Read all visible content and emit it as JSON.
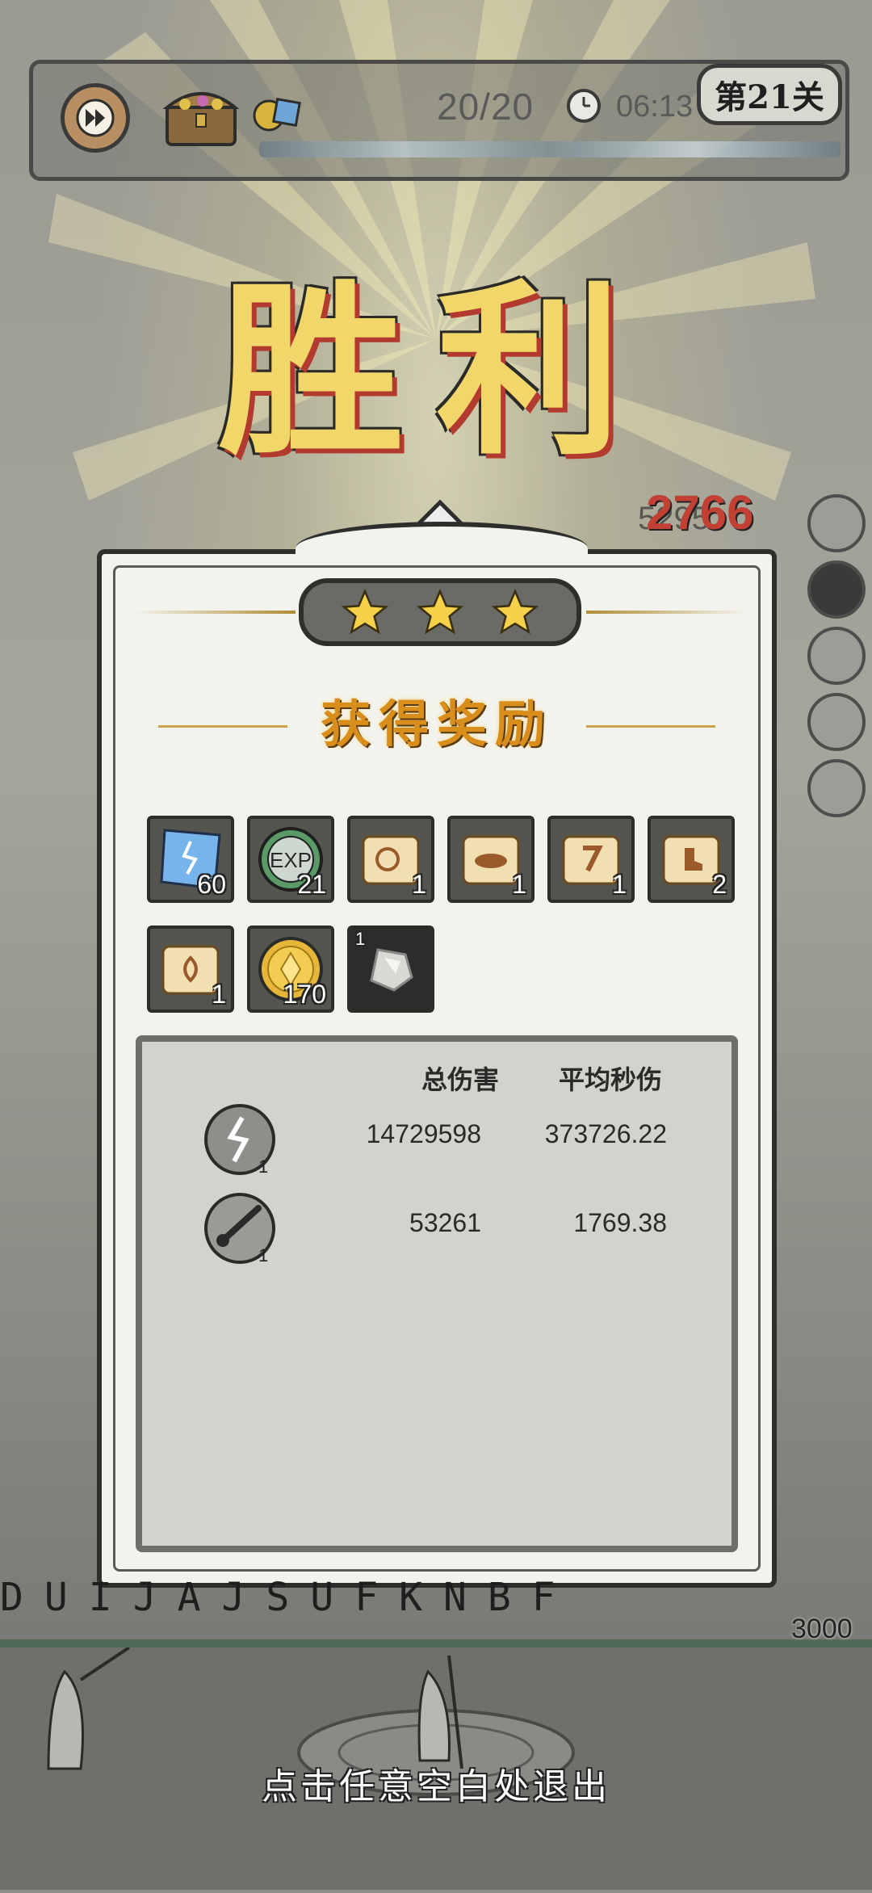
{
  "hud": {
    "wave": "20/20",
    "timer": "06:13",
    "level": "第21关"
  },
  "victory_title": "胜利",
  "floating_damage": "2766",
  "floating_damage_back": "5295",
  "stars": {
    "earned": 3,
    "total": 3
  },
  "rewards_title": "获得奖励",
  "rewards": [
    {
      "icon": "blue-crystal-icon",
      "count": "60"
    },
    {
      "icon": "exp-coin-icon",
      "count": "21"
    },
    {
      "icon": "scroll-ring-icon",
      "count": "1"
    },
    {
      "icon": "scroll-hat-icon",
      "count": "1"
    },
    {
      "icon": "scroll-hook-icon",
      "count": "1"
    },
    {
      "icon": "scroll-boot-icon",
      "count": "2"
    },
    {
      "icon": "scroll-seed-icon",
      "count": "1"
    },
    {
      "icon": "gold-coin-icon",
      "count": "170"
    },
    {
      "icon": "stone-fragment-icon",
      "count": "1"
    }
  ],
  "stats": {
    "header_total": "总伤害",
    "header_dps": "平均秒伤",
    "rows": [
      {
        "icon": "lightning-skill-icon",
        "level": "1",
        "total": "14729598",
        "dps": "373726.22"
      },
      {
        "icon": "meteor-skill-icon",
        "level": "1",
        "total": "53261",
        "dps": "1769.38"
      }
    ]
  },
  "base_hp": "3000",
  "rune_letters": "DUIJAJSUFKNBF",
  "exit_hint": "点击任意空白处退出",
  "colors": {
    "victory_gold": "#f1d76a",
    "reward_title": "#d98e1c",
    "damage_red": "#c24034"
  }
}
